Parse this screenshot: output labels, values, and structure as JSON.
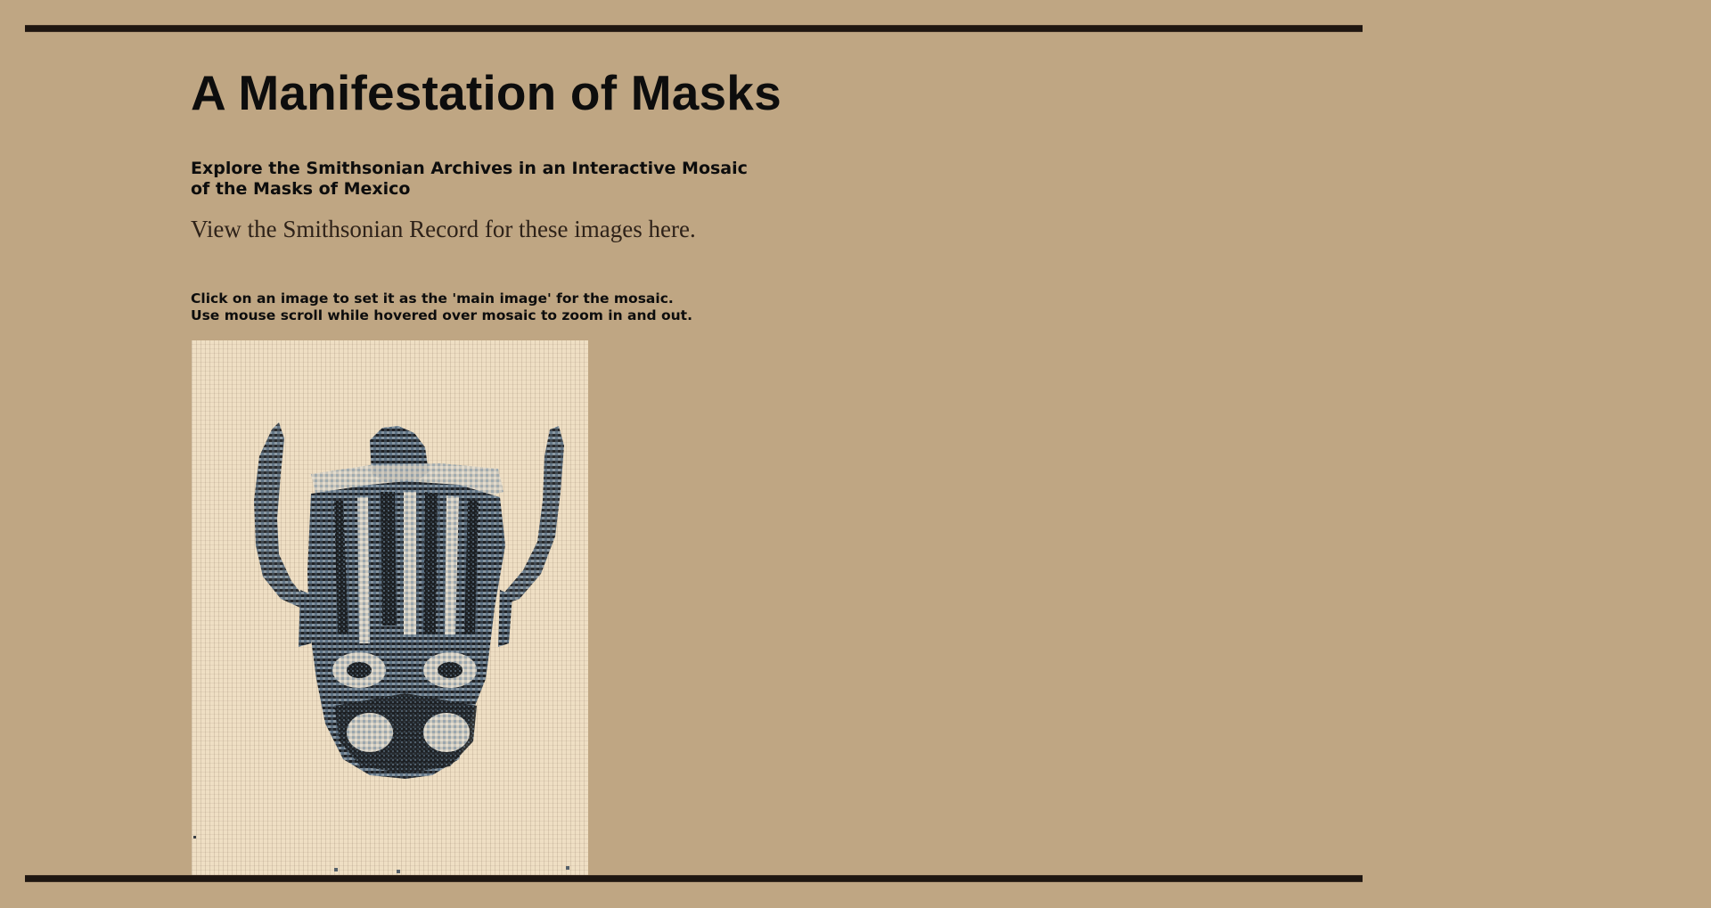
{
  "page": {
    "title": "A Manifestation of Masks",
    "subtitle": "Explore the Smithsonian Archives in an Interactive Mosaic of the Masks of Mexico",
    "record_link": "View the Smithsonian Record for these images here.",
    "instructions": [
      "Click on an image to set it as the 'main image' for the mosaic.",
      "Use mouse scroll while hovered over mosaic to zoom in and out."
    ]
  },
  "colors": {
    "background": "#bfa683",
    "rule": "#1e1611",
    "mosaic_background": "#efdfc4",
    "mosaic_tile_dark": "#2b333a",
    "mosaic_tile_blue": "#5e7284"
  },
  "mosaic": {
    "subject": "mask",
    "content": "mosaic of mask images"
  }
}
